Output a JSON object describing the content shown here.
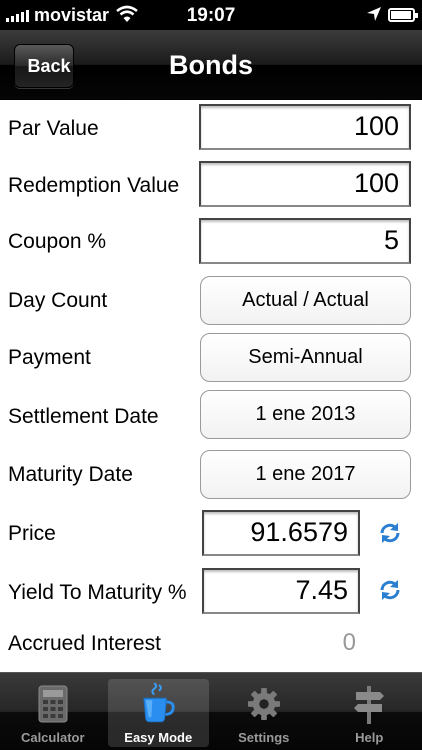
{
  "status_bar": {
    "carrier": "movistar",
    "time": "19:07"
  },
  "nav": {
    "back_label": "Back",
    "title": "Bonds"
  },
  "form": {
    "par_value": {
      "label": "Par Value",
      "value": "100"
    },
    "redemption_value": {
      "label": "Redemption Value",
      "value": "100"
    },
    "coupon": {
      "label": "Coupon %",
      "value": "5"
    },
    "day_count": {
      "label": "Day Count",
      "value": "Actual / Actual"
    },
    "payment": {
      "label": "Payment",
      "value": "Semi-Annual"
    },
    "settlement_date": {
      "label": "Settlement Date",
      "value": "1 ene 2013"
    },
    "maturity_date": {
      "label": "Maturity Date",
      "value": "1 ene 2017"
    },
    "price": {
      "label": "Price",
      "value": "91.6579"
    },
    "yield_to_maturity": {
      "label": "Yield To Maturity %",
      "value": "7.45"
    },
    "accrued_interest": {
      "label": "Accrued Interest",
      "value": "0"
    }
  },
  "tabs": [
    {
      "label": "Calculator",
      "icon": "calculator-icon",
      "active": false
    },
    {
      "label": "Easy Mode",
      "icon": "coffee-cup-icon",
      "active": true
    },
    {
      "label": "Settings",
      "icon": "gear-icon",
      "active": false
    },
    {
      "label": "Help",
      "icon": "signpost-icon",
      "active": false
    }
  ],
  "colors": {
    "accent_icon": "#2a7fd0",
    "muted_value": "#999999"
  }
}
